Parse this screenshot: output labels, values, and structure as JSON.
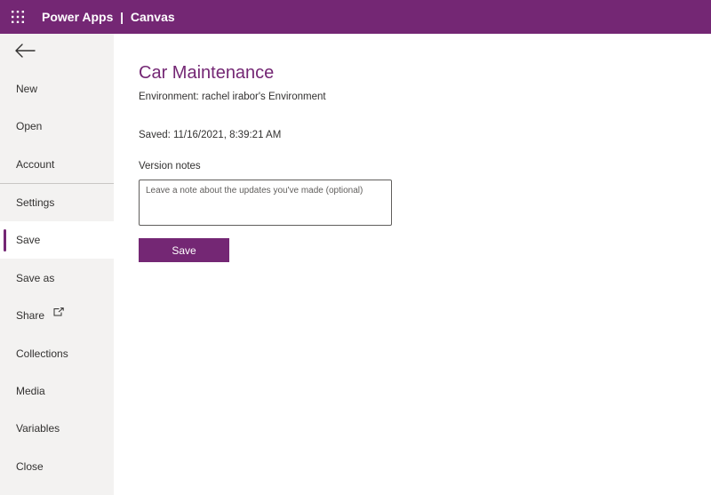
{
  "header": {
    "app_title": "Power Apps  |  Canvas",
    "accent_color": "#742774",
    "launcher_icon": "app-launcher-waffle-icon"
  },
  "sidebar": {
    "back_icon": "arrow-left-icon",
    "items": [
      {
        "label": "New",
        "active": false
      },
      {
        "label": "Open",
        "active": false
      },
      {
        "label": "Account",
        "active": false
      },
      {
        "label": "Settings",
        "active": false
      },
      {
        "label": "Save",
        "active": true
      },
      {
        "label": "Save as",
        "active": false
      },
      {
        "label": "Share",
        "active": false,
        "icon": "open-external-icon"
      },
      {
        "label": "Collections",
        "active": false
      },
      {
        "label": "Media",
        "active": false
      },
      {
        "label": "Variables",
        "active": false
      },
      {
        "label": "Close",
        "active": false
      }
    ]
  },
  "main": {
    "title": "Car Maintenance",
    "environment": "Environment: rachel irabor's Environment",
    "saved": "Saved: 11/16/2021, 8:39:21 AM",
    "version_notes_label": "Version notes",
    "version_notes_placeholder": "Leave a note about the updates you've made (optional)",
    "version_notes_value": "",
    "save_button_label": "Save"
  }
}
